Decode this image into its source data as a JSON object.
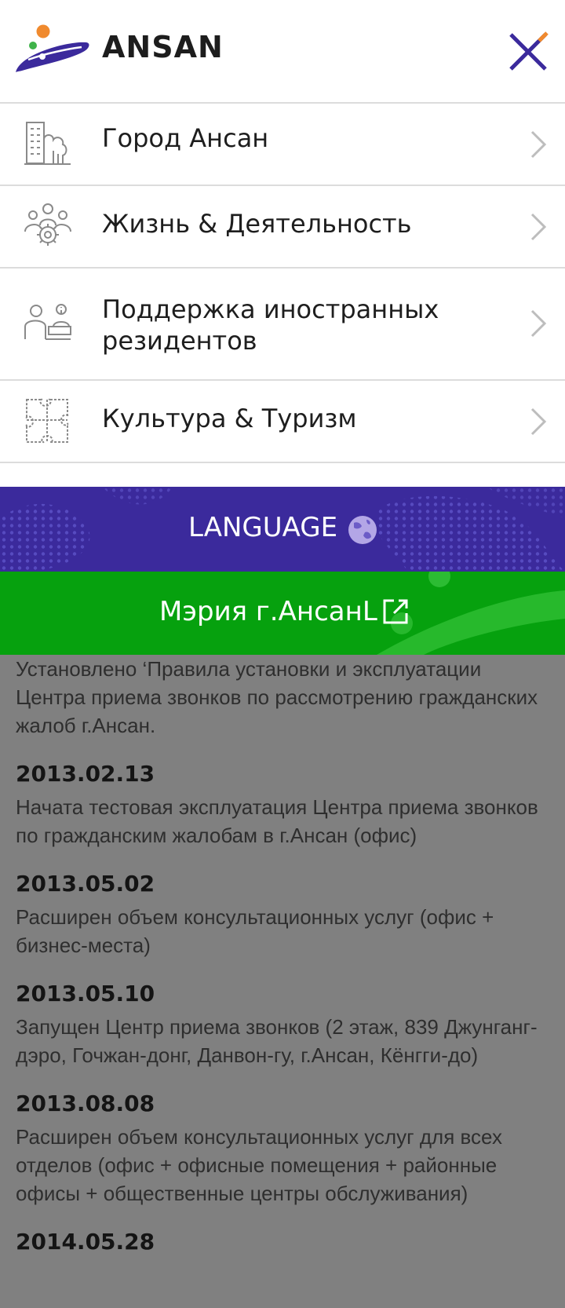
{
  "header": {
    "logo_text": "ANSAN",
    "close_label": "close menu"
  },
  "menu": {
    "items": [
      {
        "label": "Город Ансан",
        "icon": "buildings-icon"
      },
      {
        "label": "Жизнь & Деятельность",
        "icon": "people-gear-icon"
      },
      {
        "label": "Поддержка иностранных резидентов",
        "icon": "support-desk-icon"
      },
      {
        "label": "Культура & Туризм",
        "icon": "puzzle-icon"
      }
    ]
  },
  "language_bar": {
    "label": "LANGUAGE",
    "icon": "globe-icon"
  },
  "city_hall_bar": {
    "label": "Мэрия г.АнсанL",
    "icon": "external-link-icon"
  },
  "background": {
    "intro": "Установлено ‘Правила установки и эксплуатации Центра приема звонков по рассмотрению гражданских жалоб г.Ансан.",
    "timeline": [
      {
        "date": "2013.02.13",
        "text": "Начата тестовая эксплуатация Центра приема звонков по гражданским жалобам в г.Ансан (офис)"
      },
      {
        "date": "2013.05.02",
        "text": "Расширен объем консультационных услуг (офис + бизнес-места)"
      },
      {
        "date": "2013.05.10",
        "text": "Запущен Центр приема звонков (2 этаж, 839 Джунганг-дэро, Гочжан-донг, Данвон-гу, г.Ансан, Кёнгги-до)"
      },
      {
        "date": "2013.08.08",
        "text": "Расширен объем консультационных услуг для всех отделов (офис + офисные помещения + районные офисы + общественные центры обслуживания)"
      },
      {
        "date": "2014.05.28",
        "text": ""
      }
    ]
  },
  "colors": {
    "brand_purple": "#3b2a9c",
    "brand_green": "#06a10e",
    "accent_orange": "#f08a2e",
    "overlay_gray": "#808080"
  }
}
